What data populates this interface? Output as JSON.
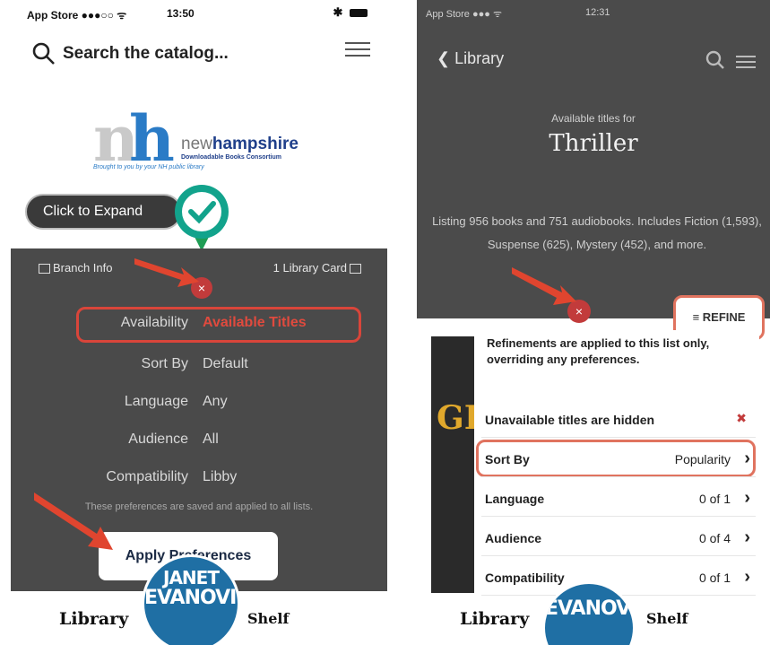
{
  "left": {
    "status": {
      "carrier": "App Store ●●●○○ ᯤ",
      "time": "13:50",
      "right": "✱"
    },
    "search": {
      "placeholder": "Search the catalog..."
    },
    "logo": {
      "n": "n",
      "h": "h",
      "name_new": "new",
      "name_hampshire": "hampshire",
      "subtitle": "Downloadable Books Consortium",
      "tagline": "Brought to you by your NH public library"
    },
    "expand_label": "Click to Expand",
    "branch_label": "Branch Info",
    "card_label": "1 Library Card",
    "prefs": [
      {
        "key": "Availability",
        "value": "Available Titles",
        "highlight": true
      },
      {
        "key": "Sort By",
        "value": "Default"
      },
      {
        "key": "Language",
        "value": "Any"
      },
      {
        "key": "Audience",
        "value": "All"
      },
      {
        "key": "Compatibility",
        "value": "Libby"
      }
    ],
    "prefs_note": "These preferences are saved and applied to all lists.",
    "apply_label": "Apply Preferences",
    "nav": {
      "library": "Library",
      "shelf": "Shelf",
      "book_line1": "JANET",
      "book_line2": "EVANOVICH"
    }
  },
  "right": {
    "status": {
      "carrier": "App Store ●●● ᯤ",
      "time": "12:31"
    },
    "back_label": "Library",
    "available_for": "Available titles for",
    "genre": "Thriller",
    "listing": "Listing 956 books and 751 audiobooks. Includes Fiction (1,593), Suspense (625), Mystery (452), and more.",
    "refine_label": "REFINE",
    "book_title_letters": "GR",
    "refine_note": "Refinements are applied to this list only, overriding any preferences.",
    "rows": [
      {
        "key": "Unavailable titles are hidden",
        "value": "",
        "icon": "x"
      },
      {
        "key": "Sort By",
        "value": "Popularity",
        "icon": "chevron"
      },
      {
        "key": "Language",
        "value": "0 of 1",
        "icon": "chevron"
      },
      {
        "key": "Audience",
        "value": "0 of 4",
        "icon": "chevron"
      },
      {
        "key": "Compatibility",
        "value": "0 of 1",
        "icon": "chevron"
      }
    ],
    "nav": {
      "library": "Library",
      "shelf": "Shelf",
      "book_line1": "EVANOVICH"
    }
  },
  "colors": {
    "accent_red": "#d9453a",
    "badge_blue": "#1f6fa4",
    "pin_teal": "#12a38c",
    "panel_dark": "#4a4a4a"
  }
}
